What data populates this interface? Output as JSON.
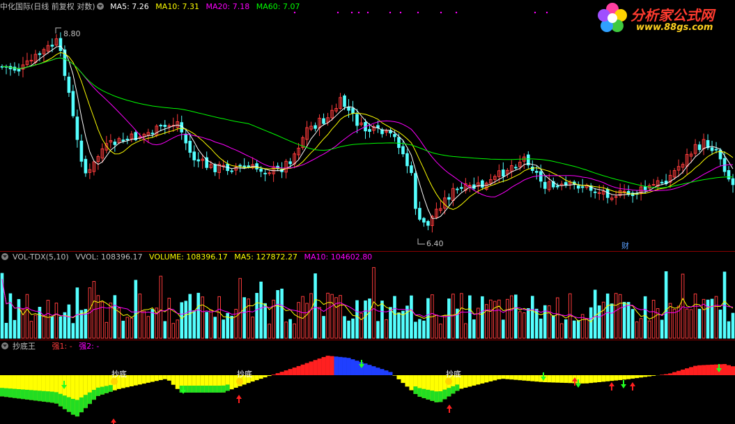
{
  "price_panel": {
    "stock_name": "中化国际",
    "period_label": "(日线 前复权 对数)",
    "ma5": "MA5: 7.26",
    "ma10": "MA10: 7.31",
    "ma20": "MA20: 7.18",
    "ma60": "MA60: 7.07",
    "high_marker": "8.80",
    "low_marker": "6.40",
    "finance_marker": "财",
    "colors": {
      "up": "#ff3c3c",
      "down": "#54ffff",
      "ma5": "#ffffff",
      "ma10": "#ffff00",
      "ma20": "#ff00ff",
      "ma60": "#00ff00"
    }
  },
  "volume_panel": {
    "indicator": "VOL-TDX(5,10)",
    "vvol": "VVOL: 108396.17",
    "volume": "VOLUME: 108396.17",
    "ma5": "MA5: 127872.27",
    "ma10": "MA10: 104602.80"
  },
  "signal_panel": {
    "indicator": "抄底王",
    "strong1": "强1: -",
    "strong2": "强2: -",
    "bottom_label": "抄底"
  },
  "logo": {
    "name": "分析家公式网",
    "url": "www.88gs.com"
  }
}
